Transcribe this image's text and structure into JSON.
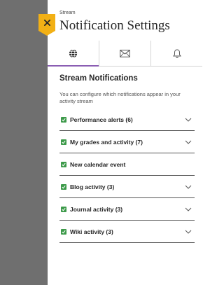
{
  "header": {
    "breadcrumb": "Stream",
    "title": "Notification Settings",
    "close_icon": "close-icon"
  },
  "tabs": [
    {
      "icon": "globe-icon",
      "active": true
    },
    {
      "icon": "envelope-icon",
      "active": false
    },
    {
      "icon": "bell-icon",
      "active": false
    }
  ],
  "section": {
    "title": "Stream Notifications",
    "description": "You can configure which notifications appear in your activity stream"
  },
  "items": [
    {
      "label": "Performance alerts (6)",
      "checked": true,
      "expandable": true
    },
    {
      "label": "My grades and activity (7)",
      "checked": true,
      "expandable": true
    },
    {
      "label": "New calendar event",
      "checked": true,
      "expandable": false
    },
    {
      "label": "Blog activity (3)",
      "checked": true,
      "expandable": true
    },
    {
      "label": "Journal activity (3)",
      "checked": true,
      "expandable": true
    },
    {
      "label": "Wiki activity (3)",
      "checked": true,
      "expandable": true
    }
  ],
  "colors": {
    "accent": "#8a5db3",
    "close_button": "#f2b015",
    "checkbox": "#3d9a4a",
    "backdrop": "#6f6f6f"
  }
}
